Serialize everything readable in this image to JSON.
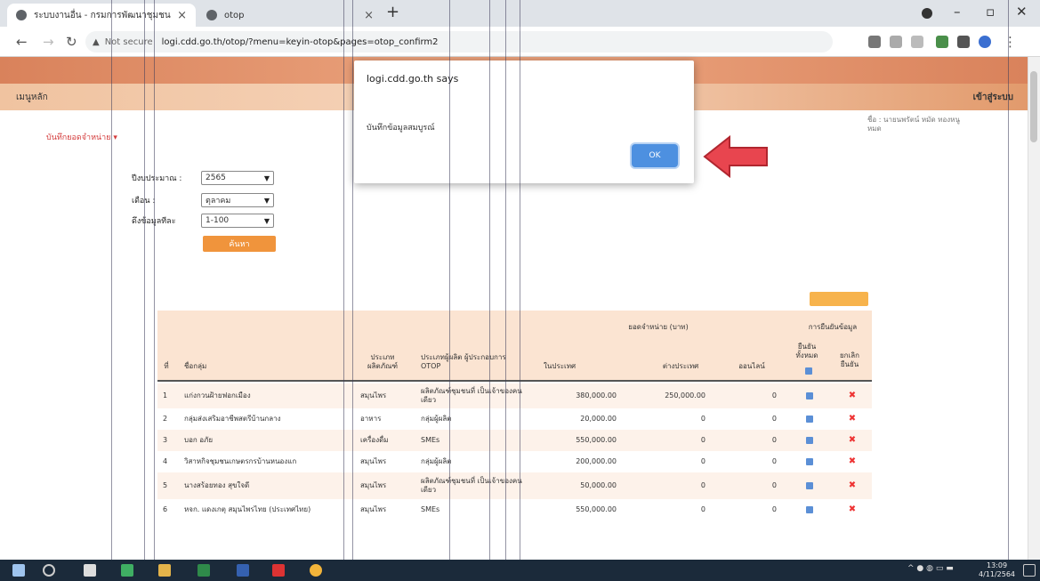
{
  "browser": {
    "tabs": [
      {
        "title": "ระบบงานอื่น - กรมการพัฒนาชุมชน",
        "active": true
      },
      {
        "title": "otop",
        "active": false
      }
    ],
    "new_tab": "+",
    "security_label": "Not secure",
    "url": "logi.cdd.go.th/otop/?menu=keyin-otop&pages=otop_confirm2"
  },
  "header": {
    "menu_label": "เมนูหลัก",
    "login_link": "เข้าสู่ระบบ",
    "user_info": "ชื่อ : นายนพรัตน์ หมัด ทองหนู หมด",
    "breadcrumb": "บันทึกยอดจำหน่าย ▾"
  },
  "filters": {
    "year_label": "ปีงบประมาณ :",
    "year_value": "2565",
    "month_label": "เดือน :",
    "month_value": "ตุลาคม",
    "rows_label": "ดึงข้อมูลทีละ",
    "rows_value": "1-100",
    "search_button": "ค้นหา"
  },
  "dialog": {
    "title": "logi.cdd.go.th says",
    "message": "บันทึกข้อมูลสมบูรณ์",
    "ok_label": "OK"
  },
  "table": {
    "group_headers": {
      "sales": "ยอดจำหน่าย (บาท)",
      "confirm": "การยืนยันข้อมูล"
    },
    "columns": {
      "no": "ที่",
      "name": "ชื่อกลุ่ม",
      "type": "ประเภท ผลิตภัณฑ์",
      "category": "ประเภทผู้ผลิต ผู้ประกอบการ OTOP",
      "in_province": "ในประเทศ",
      "abroad": "ต่างประเทศ",
      "online": "ออนไลน์",
      "confirm_all": "ยืนยัน ทั้งหมด",
      "cancel": "ยกเลิก ยืนยัน"
    },
    "rows": [
      {
        "no": "1",
        "name": "แก่งกวนฝ้ายฟอกเมือง",
        "type": "สมุนไพร",
        "category": "ผลิตภัณฑ์ชุมชนที่ เป็นเจ้าของคนเดียว",
        "in_province": "380,000.00",
        "abroad": "250,000.00",
        "online": "0"
      },
      {
        "no": "2",
        "name": "กลุ่มส่งเสริมอาชีพสตรีบ้านกลาง",
        "type": "อาหาร",
        "category": "กลุ่มผู้ผลิต",
        "in_province": "20,000.00",
        "abroad": "0",
        "online": "0"
      },
      {
        "no": "3",
        "name": "บอก อภัย",
        "type": "เครื่องดื่ม",
        "category": "SMEs",
        "in_province": "550,000.00",
        "abroad": "0",
        "online": "0"
      },
      {
        "no": "4",
        "name": "วิสาหกิจชุมชนเกษตรกรบ้านหนองแก",
        "type": "สมุนไพร",
        "category": "กลุ่มผู้ผลิต",
        "in_province": "200,000.00",
        "abroad": "0",
        "online": "0"
      },
      {
        "no": "5",
        "name": "นางสร้อยทอง สุขใจดี",
        "type": "สมุนไพร",
        "category": "ผลิตภัณฑ์ชุมชนที่ เป็นเจ้าของคนเดียว",
        "in_province": "50,000.00",
        "abroad": "0",
        "online": "0"
      },
      {
        "no": "6",
        "name": "หจก. แดงเกตุ สมุนไพรไทย (ประเทศไทย)",
        "type": "สมุนไพร",
        "category": "SMEs",
        "in_province": "550,000.00",
        "abroad": "0",
        "online": "0"
      }
    ]
  },
  "taskbar": {
    "time": "13:09",
    "date": "4/11/2564"
  },
  "colors": {
    "accent": "#f0943c",
    "header_band": "#e29a6c",
    "ok_button": "#4d90e0",
    "arrow": "#e8454f"
  }
}
